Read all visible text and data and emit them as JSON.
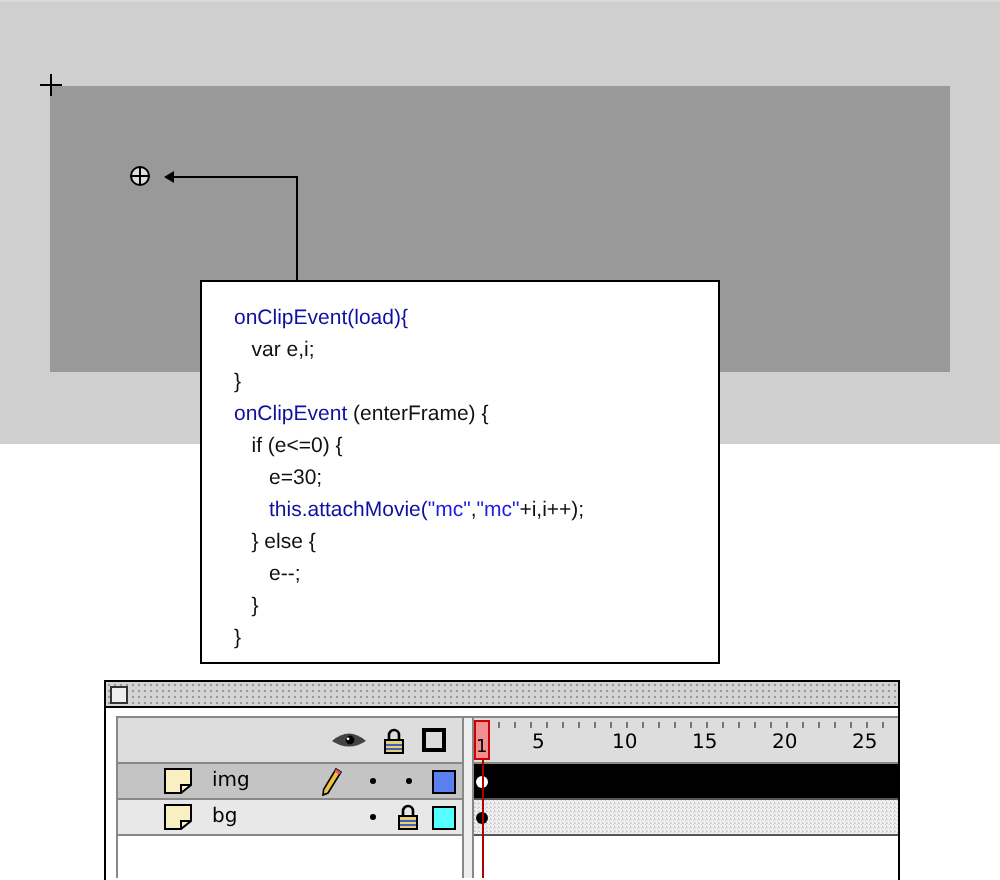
{
  "code_lines": [
    {
      "tokens": [
        {
          "kind": "keyword",
          "text": "onClipEvent(load){"
        }
      ]
    },
    {
      "tokens": [
        {
          "kind": "plain",
          "text": "   var e,i;"
        }
      ]
    },
    {
      "tokens": [
        {
          "kind": "plain",
          "text": "}"
        }
      ]
    },
    {
      "tokens": [
        {
          "kind": "keyword",
          "text": "onClipEvent"
        },
        {
          "kind": "plain",
          "text": " (enterFrame) {"
        }
      ]
    },
    {
      "tokens": [
        {
          "kind": "plain",
          "text": "   if (e<=0) {"
        }
      ]
    },
    {
      "tokens": [
        {
          "kind": "plain",
          "text": "      e=30;"
        }
      ]
    },
    {
      "tokens": [
        {
          "kind": "keyword",
          "text": "      this.attachMovie("
        },
        {
          "kind": "string",
          "text": "\"mc\""
        },
        {
          "kind": "plain",
          "text": ","
        },
        {
          "kind": "string",
          "text": "\"mc\""
        },
        {
          "kind": "plain",
          "text": "+i,i++);"
        }
      ]
    },
    {
      "tokens": [
        {
          "kind": "plain",
          "text": "   } else {"
        }
      ]
    },
    {
      "tokens": [
        {
          "kind": "plain",
          "text": "      e--;"
        }
      ]
    },
    {
      "tokens": [
        {
          "kind": "plain",
          "text": "   }"
        }
      ]
    },
    {
      "tokens": [
        {
          "kind": "plain",
          "text": "}"
        }
      ]
    }
  ],
  "timeline": {
    "ruler": [
      {
        "label": "1",
        "selected": true
      },
      {
        "label": "5",
        "selected": false
      },
      {
        "label": "10",
        "selected": false
      },
      {
        "label": "15",
        "selected": false
      },
      {
        "label": "20",
        "selected": false
      },
      {
        "label": "25",
        "selected": false
      }
    ],
    "layers": [
      {
        "name": "img",
        "selected": true,
        "editing": true,
        "visible": true,
        "locked": false,
        "color": "#5a7ff0"
      },
      {
        "name": "bg",
        "selected": false,
        "editing": false,
        "visible": true,
        "locked": true,
        "color": "#55ffff"
      }
    ]
  }
}
